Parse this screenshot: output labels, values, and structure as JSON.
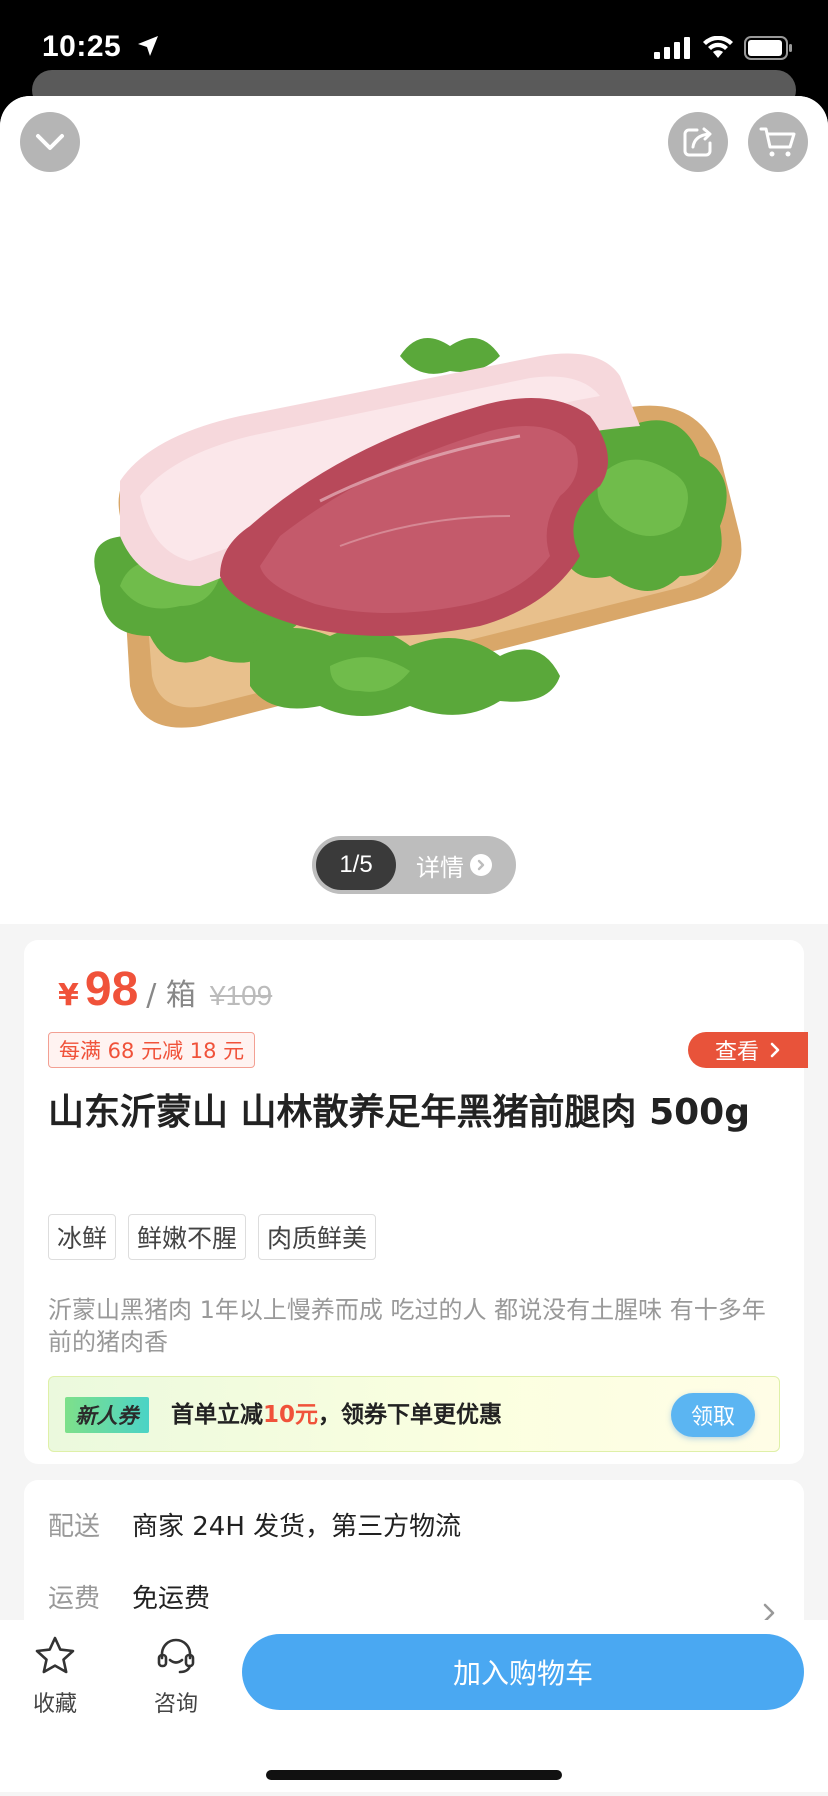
{
  "status": {
    "time": "10:25"
  },
  "gallery": {
    "index": "1/5",
    "detail_label": "详情"
  },
  "price": {
    "symbol": "¥",
    "value": "98",
    "unit": "/ 箱",
    "original": "¥109"
  },
  "promotion": {
    "text": "每满 68 元减 18 元",
    "view_label": "查看"
  },
  "product": {
    "title": "山东沂蒙山 山林散养足年黑猪前腿肉 500g",
    "tags": [
      "冰鲜",
      "鲜嫩不腥",
      "肉质鲜美"
    ],
    "description": "沂蒙山黑猪肉 1年以上慢养而成 吃过的人 都说没有土腥味 有十多年前的猪肉香"
  },
  "coupon": {
    "badge": "新人券",
    "text_prefix": "首单立减",
    "amount": "10元",
    "text_suffix": "，领券下单更优惠",
    "button": "领取"
  },
  "shipping": {
    "delivery_label": "配送",
    "delivery_value": "商家 24H 发货，第三方物流",
    "fee_label": "运费",
    "fee_value": "免运费"
  },
  "bottom": {
    "favorite_label": "收藏",
    "consult_label": "咨询",
    "add_to_cart_label": "加入购物车"
  },
  "colors": {
    "accent_price": "#f0523a",
    "primary_button": "#4aa8f2"
  }
}
